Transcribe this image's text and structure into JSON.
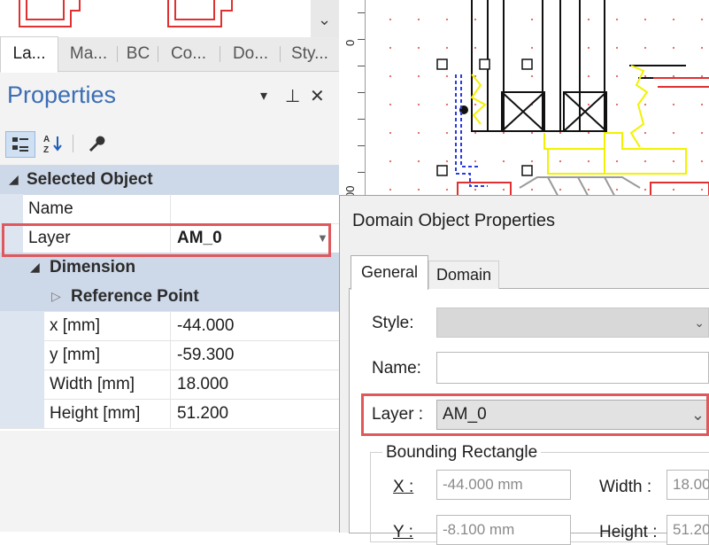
{
  "left_panel": {
    "tabs": [
      {
        "label": "La...",
        "active": true
      },
      {
        "label": "Ma...",
        "active": false
      },
      {
        "label": "BC",
        "active": false
      },
      {
        "label": "Co...",
        "active": false
      },
      {
        "label": "Do...",
        "active": false
      },
      {
        "label": "Sty...",
        "active": false
      }
    ],
    "title": "Properties",
    "title_controls": {
      "dropdown": "▾",
      "pin": "⊥",
      "close": "✕"
    },
    "toolbar_icons": [
      "categorized-icon",
      "alphabetical-sort-icon",
      "wrench-icon"
    ],
    "grid": {
      "selected_object": "Selected Object",
      "name_label": "Name",
      "name_value": "",
      "layer_label": "Layer",
      "layer_value": "AM_0",
      "dimension": "Dimension",
      "reference_point": "Reference Point",
      "x_label": "x [mm]",
      "x_value": "-44.000",
      "y_label": "y [mm]",
      "y_value": "-59.300",
      "width_label": "Width [mm]",
      "width_value": "18.000",
      "height_label": "Height [mm]",
      "height_value": "51.200"
    }
  },
  "ruler": {
    "labels": [
      "0",
      "00"
    ]
  },
  "dialog": {
    "title": "Domain Object Properties",
    "tabs": [
      {
        "label": "General",
        "active": true
      },
      {
        "label": "Domain",
        "active": false
      }
    ],
    "style_label": "Style:",
    "name_label": "Name:",
    "layer_label": "Layer :",
    "layer_value": "AM_0",
    "bounding_title": "Bounding Rectangle",
    "x_label": "X :",
    "x_value": "-44.000 mm",
    "width_label": "Width :",
    "width_value": "18.00",
    "y_label": "Y :",
    "y_value": "-8.100 mm",
    "height_label": "Height :",
    "height_value": "51.20"
  },
  "colors": {
    "title_blue": "#3b6eb4",
    "highlight_red": "#e0585c",
    "cad_yellow": "#f2f200",
    "cad_red": "#e03030",
    "cad_blue": "#2a3adf"
  }
}
